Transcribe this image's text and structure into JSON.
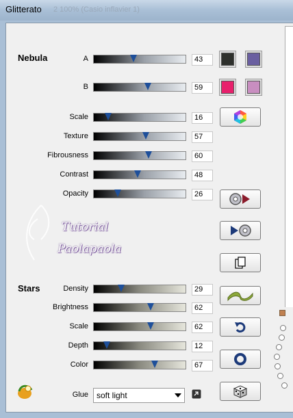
{
  "window": {
    "title": "Glitterato",
    "ghost_title": "2 100% (Casio inflavier 1)"
  },
  "nebula": {
    "title": "Nebula",
    "sliders": [
      {
        "label": "A",
        "value": "43"
      },
      {
        "label": "B",
        "value": "59"
      },
      {
        "label": "Scale",
        "value": "16"
      },
      {
        "label": "Texture",
        "value": "57"
      },
      {
        "label": "Fibrousness",
        "value": "60"
      },
      {
        "label": "Contrast",
        "value": "48"
      },
      {
        "label": "Opacity",
        "value": "26"
      }
    ],
    "colors": {
      "a1": "#2e302c",
      "a2": "#6a5fa0",
      "b1": "#e8206c",
      "b2": "#c88ec0"
    }
  },
  "stars": {
    "title": "Stars",
    "sliders": [
      {
        "label": "Density",
        "value": "29"
      },
      {
        "label": "Brightness",
        "value": "62"
      },
      {
        "label": "Scale",
        "value": "62"
      },
      {
        "label": "Depth",
        "value": "12"
      },
      {
        "label": "Color",
        "value": "67"
      }
    ]
  },
  "glue": {
    "label": "Glue",
    "selected": "soft light"
  },
  "watermark": {
    "line1": "Tutorial",
    "line2": "Paolapaola"
  },
  "icons": [
    "color-wheel-icon",
    "disc-arrow-right-icon",
    "arrow-disc-icon",
    "copy-page-icon",
    "wave-icon",
    "undo-arrow-icon",
    "ring-icon",
    "dice-icon",
    "bulb-logo-icon",
    "link-icon"
  ]
}
